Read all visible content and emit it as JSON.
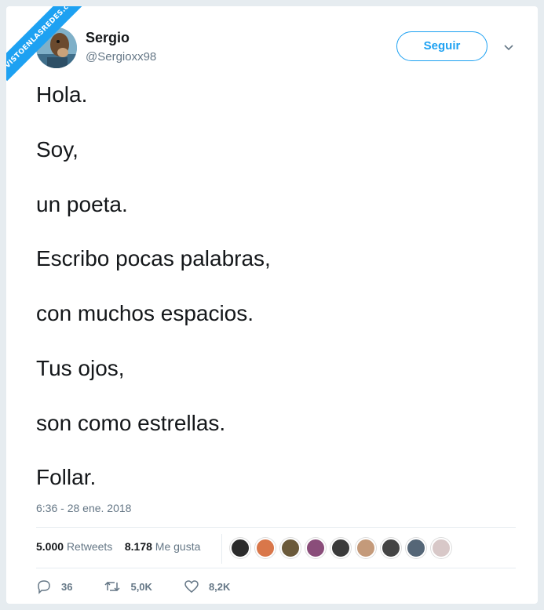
{
  "watermark": "VISTOENLASREDES.com",
  "user": {
    "name": "Sergio",
    "handle": "@Sergioxx98"
  },
  "follow_label": "Seguir",
  "tweet_lines": [
    "Hola.",
    "Soy,",
    "un poeta.",
    "Escribo pocas palabras,",
    "con muchos espacios.",
    "Tus ojos,",
    "son como estrellas.",
    "Follar."
  ],
  "timestamp": "6:36 - 28 ene. 2018",
  "stats": {
    "retweets_count": "5.000",
    "retweets_label": "Retweets",
    "likes_count": "8.178",
    "likes_label": "Me gusta"
  },
  "liker_avatars": [
    "#2b2b2b",
    "#d9774a",
    "#6b5a3a",
    "#8a4d7a",
    "#3a3a3a",
    "#c49a7a",
    "#444444",
    "#556677",
    "#d8c8c8"
  ],
  "actions": {
    "replies": "36",
    "retweets": "5,0K",
    "likes": "8,2K"
  },
  "colors": {
    "accent": "#1da1f2",
    "text": "#14171a",
    "muted": "#657786"
  }
}
